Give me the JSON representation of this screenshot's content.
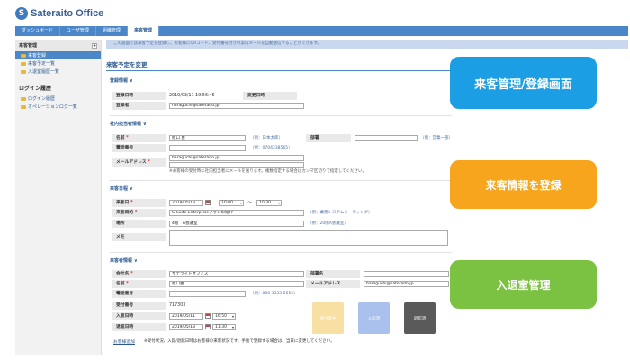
{
  "app": {
    "logo_letter": "S",
    "logo_name": "Sateraito Office"
  },
  "nav": {
    "tabs": [
      {
        "label": "ダッシュボード"
      },
      {
        "label": "ユーザ管理"
      },
      {
        "label": "組織管理"
      },
      {
        "label": "来客管理",
        "active": true
      }
    ]
  },
  "sidebar": {
    "visitor_title": "来客管理",
    "toggle": "+",
    "items": [
      {
        "label": "来客登録"
      },
      {
        "label": "来客予定一覧"
      },
      {
        "label": "入退室履歴一覧"
      }
    ],
    "log_title": "ログイン履歴",
    "log_items": [
      {
        "label": "ログイン履歴"
      },
      {
        "label": "オペレーションログ一覧"
      }
    ]
  },
  "notice": "この画面では来客予定を登録し、お客様にQRコード、受付番号付きの案内メールを自動送信することができます。",
  "page_title": "来客予定を変更",
  "registration": {
    "title": "登録情報 ∨",
    "registered_at_label": "登録日時",
    "registered_at": "2019/03/11 19:56:45",
    "updated_at_label": "変更日時",
    "registrant_label": "登録者",
    "registrant": "haraguchi@sateraito.jp"
  },
  "staff": {
    "title": "社内担当者情報 ∨",
    "name_label": "名前",
    "name": "原口 豊",
    "name_hint": "（例：日本太郎）",
    "dept_label": "部署",
    "dept_hint": "（例：営業一部）",
    "phone_label": "電話番号",
    "phone_hint": "（例：0704238565）",
    "email_label": "メールアドレス",
    "email": "haraguchi@sateraito.jp",
    "email_note": "※お客様の受付時に社内担当者にメールを送ります。複数指定する場合はカンマ区切りで指定してください。"
  },
  "schedule": {
    "title": "来客日程 ∨",
    "date_label": "来客日",
    "date": "2019/05/13",
    "time_from": "10:00",
    "tilde": "〜",
    "time_to": "10:30",
    "purpose_label": "来客目的",
    "purpose": "G Suite Enterpriseプランの紹介",
    "purpose_hint": "（例：業務システムミーティング）",
    "place_label": "場所",
    "place": "4階　A会議室",
    "place_hint": "（例：20階A会議室）",
    "memo_label": "メモ"
  },
  "visitor": {
    "title": "来客者情報 ∨",
    "company_label": "会社名",
    "company": "サテライトオフィス",
    "dept_label": "部署名",
    "name_label": "名前",
    "name": "原口豊",
    "email_label": "メールアドレス",
    "email": "haraguchi@sateraito.jp",
    "phone_label": "電話番号",
    "phone_hint": "（例：080-3333-5555）",
    "receipt_label": "受付番号",
    "receipt": "717303",
    "entry_label": "入室日時",
    "entry_date": "2019/05/11",
    "entry_time": "16:50",
    "exit_label": "退館日時",
    "exit_date": "2019/05/13",
    "exit_time": "11:30"
  },
  "buttons": {
    "b1": "受付発生",
    "b2": "入館済",
    "b3": "退館済"
  },
  "footer": {
    "link": "お客様追加",
    "note": "※受付状況、入館/退館日時はお客様の来客状況です。手動で登録する場合は、当日に変更してください。"
  },
  "callouts": {
    "c1": "来客管理/登録画面",
    "c2": "来客情報を登録",
    "c3": "入退室管理"
  },
  "colors": {
    "callout_blue": "#1b9ee3",
    "callout_orange": "#f6a51c",
    "callout_green": "#7cc242"
  }
}
